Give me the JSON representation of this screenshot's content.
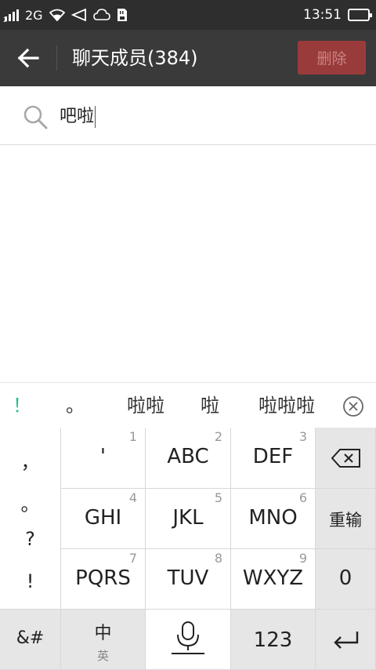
{
  "status_bar": {
    "network": "2G",
    "sim_slot": "2",
    "time": "13:51"
  },
  "header": {
    "title": "聊天成员(384)",
    "delete_label": "删除",
    "delete_color": "#9a3b3b"
  },
  "search": {
    "value": "吧啦"
  },
  "candidates": {
    "items": [
      "！",
      "。",
      "啦啦",
      "啦",
      "啦啦啦"
    ]
  },
  "keyboard": {
    "punctuation": [
      "，",
      "。",
      "?",
      "!"
    ],
    "keys": [
      {
        "label": "'",
        "num": "1"
      },
      {
        "label": "ABC",
        "num": "2"
      },
      {
        "label": "DEF",
        "num": "3"
      },
      {
        "label": "GHI",
        "num": "4"
      },
      {
        "label": "JKL",
        "num": "5"
      },
      {
        "label": "MNO",
        "num": "6"
      },
      {
        "label": "PQRS",
        "num": "7"
      },
      {
        "label": "TUV",
        "num": "8"
      },
      {
        "label": "WXYZ",
        "num": "9"
      }
    ],
    "reinput_label": "重输",
    "zero_label": "0",
    "symbols_label": "&#",
    "lang_main": "中",
    "lang_sub": "英",
    "numbers_label": "123"
  },
  "icons": {
    "back": "arrow-left-icon",
    "search": "search-icon",
    "backspace": "backspace-icon",
    "mic": "microphone-icon",
    "enter": "enter-icon",
    "close_candidates": "close-circle-icon",
    "wifi": "wifi-icon",
    "cloud": "cloud-icon"
  }
}
